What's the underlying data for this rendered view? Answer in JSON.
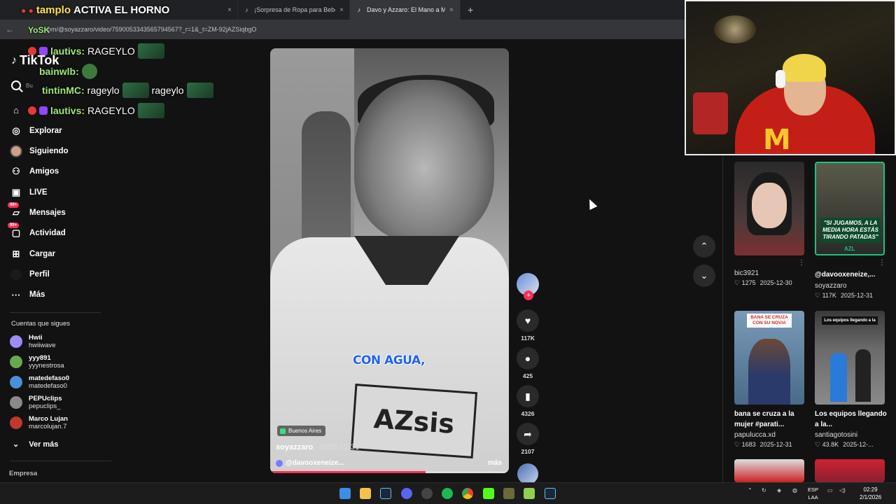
{
  "browser": {
    "tabs": [
      {
        "label": "",
        "active": false
      },
      {
        "label": "¡Sorpresa de Ropa para Bebé! |",
        "active": false
      },
      {
        "label": "Davo y Azzaro: El Mano a M",
        "active": true
      }
    ],
    "close_glyph": "×",
    "newtab_glyph": "+",
    "url": "om/@soyazzaro/video/7590053343565794567?_r=1&_t=ZM-92jAZSiqbgO"
  },
  "overlay": {
    "title_prefix": "tamplo",
    "title_main": "ACTIVA EL HORNO",
    "user_label": "YoSK",
    "chat": [
      {
        "user": "lautivs:",
        "msg": "RAGEYLO"
      },
      {
        "user": "bainwlb:",
        "msg": ""
      },
      {
        "user": "tintinMC:",
        "msg": "rageylo",
        "msg2": "rageylo"
      },
      {
        "user": "lautivs:",
        "msg": "RAGEYLO"
      }
    ]
  },
  "tiktok": {
    "logo": "TikTok",
    "search_placeholder": "Bu",
    "nav": [
      {
        "label": "Explorar",
        "icon": "compass-icon"
      },
      {
        "label": "Siguiendo",
        "icon": "following-avatar-icon"
      },
      {
        "label": "Amigos",
        "icon": "friends-icon"
      },
      {
        "label": "LIVE",
        "icon": "live-icon"
      },
      {
        "label": "Mensajes",
        "icon": "messages-icon",
        "badge": "99+"
      },
      {
        "label": "Actividad",
        "icon": "activity-icon",
        "badge": "99+"
      },
      {
        "label": "Cargar",
        "icon": "upload-icon"
      },
      {
        "label": "Perfil",
        "icon": "profile-icon"
      },
      {
        "label": "Más",
        "icon": "more-icon"
      }
    ],
    "following_title": "Cuentas que sigues",
    "following": [
      {
        "name": "Hwii",
        "handle": "hwiiwave",
        "color": "#9a8cff"
      },
      {
        "name": "yyy891",
        "handle": "yyynestrosa",
        "color": "#6aa84f"
      },
      {
        "name": "matedefaso0",
        "handle": "matedefaso0",
        "color": "#4a90d9"
      },
      {
        "name": "PEPUclips",
        "handle": "pepuclips_",
        "color": "#8a8a8a"
      },
      {
        "name": "Marco Lujan",
        "handle": "marcolujan.7",
        "color": "#c0392b"
      }
    ],
    "see_more": "Ver más",
    "company": "Empresa"
  },
  "video": {
    "caption": "CON AGUA,",
    "logo_text": "AZsis",
    "location": "Buenos Aires",
    "author": "soyazzaro",
    "date": "2025-12-31",
    "mention": "@davooxeneize...",
    "more": "más",
    "progress": 0.65
  },
  "actions": {
    "likes": "117K",
    "comments": "425",
    "saves": "4326",
    "shares": "2107",
    "follow_plus": "+",
    "like_icon": "heart-icon",
    "comment_icon": "comment-icon",
    "save_icon": "bookmark-icon",
    "share_icon": "share-icon"
  },
  "nav_arrows": {
    "up": "⌃",
    "down": "⌄"
  },
  "recommended": [
    {
      "author": "bic3921",
      "likes": "1275",
      "date": "2025-12-30",
      "title": ""
    },
    {
      "title": "@davooxeneize,...",
      "author": "soyazzaro",
      "likes": "117K",
      "date": "2025-12-31",
      "thumb_text": "\"SI JUGAMOS, A LA MEDIA HORA ESTÁS TIRANDO PATADAS\"",
      "thumb_logo": "AZL"
    },
    {
      "title": "bana se cruza a la mujer #parati...",
      "author": "papulucca.xd",
      "likes": "1683",
      "date": "2025-12-31",
      "thumb_a": "BANA SE CRUZA",
      "thumb_b": "CON SU NOVIA"
    },
    {
      "title": "Los equipos llegando a la...",
      "author": "santiagotosini",
      "likes": "43.8K",
      "date": "2025-12-...",
      "thumb_text": "Los equipos llegando a la"
    }
  ],
  "taskbar": {
    "lang_top": "ESP",
    "lang_bottom": "LAA",
    "time": "02:29",
    "date": "2/1/2026"
  }
}
